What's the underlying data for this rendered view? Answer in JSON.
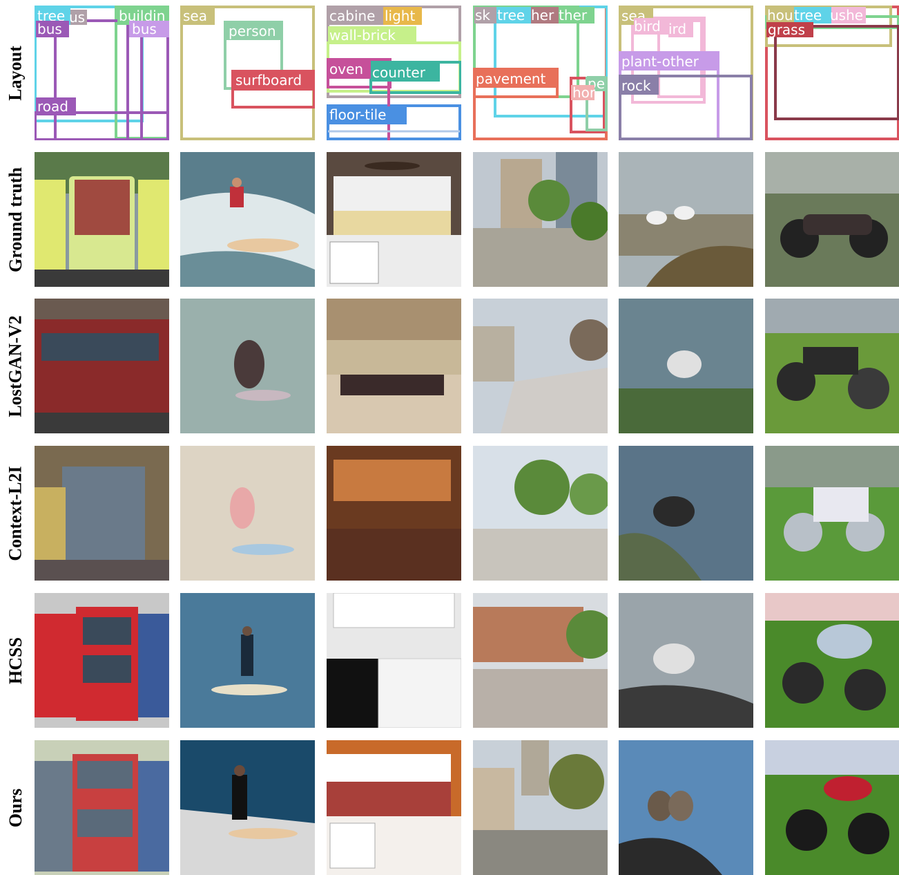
{
  "rows": [
    {
      "label": "Layout"
    },
    {
      "label": "Ground truth"
    },
    {
      "label": "LostGAN-V2"
    },
    {
      "label": "Context-L2I"
    },
    {
      "label": "HCSS"
    },
    {
      "label": "Ours"
    }
  ],
  "layout_columns": [
    {
      "labels": [
        "tree",
        "us",
        "bus",
        "buildin",
        "bus",
        "road"
      ]
    },
    {
      "labels": [
        "sea",
        "person",
        "surfboard"
      ]
    },
    {
      "labels": [
        "cabine",
        "light",
        "wall-brick",
        "oven",
        "counter",
        "floor-tile"
      ]
    },
    {
      "labels": [
        "sk",
        "tree",
        "her",
        "ther",
        "pavement",
        "pe",
        "hor"
      ]
    },
    {
      "labels": [
        "sea",
        "bird",
        "ird",
        "plant-other",
        "rock"
      ]
    },
    {
      "labels": [
        "hou",
        "tree",
        "ushe",
        "grass"
      ]
    }
  ],
  "colors": {
    "purple": "#9b59b6",
    "cyan": "#5fd3e8",
    "green": "#7ed38f",
    "olive": "#c8c07a",
    "sage": "#8fcfa8",
    "red": "#d9535f",
    "lime": "#c6f08a",
    "magenta": "#c6509a",
    "teal": "#3cb5a0",
    "blue": "#4a90e2",
    "gray": "#b0a0a8",
    "salmon": "#e8705a",
    "pink": "#f2b8d8",
    "lavender": "#c79be8",
    "slate": "#8a7fa8",
    "maroon": "#8a3a4a",
    "darkred": "#c0404a"
  }
}
